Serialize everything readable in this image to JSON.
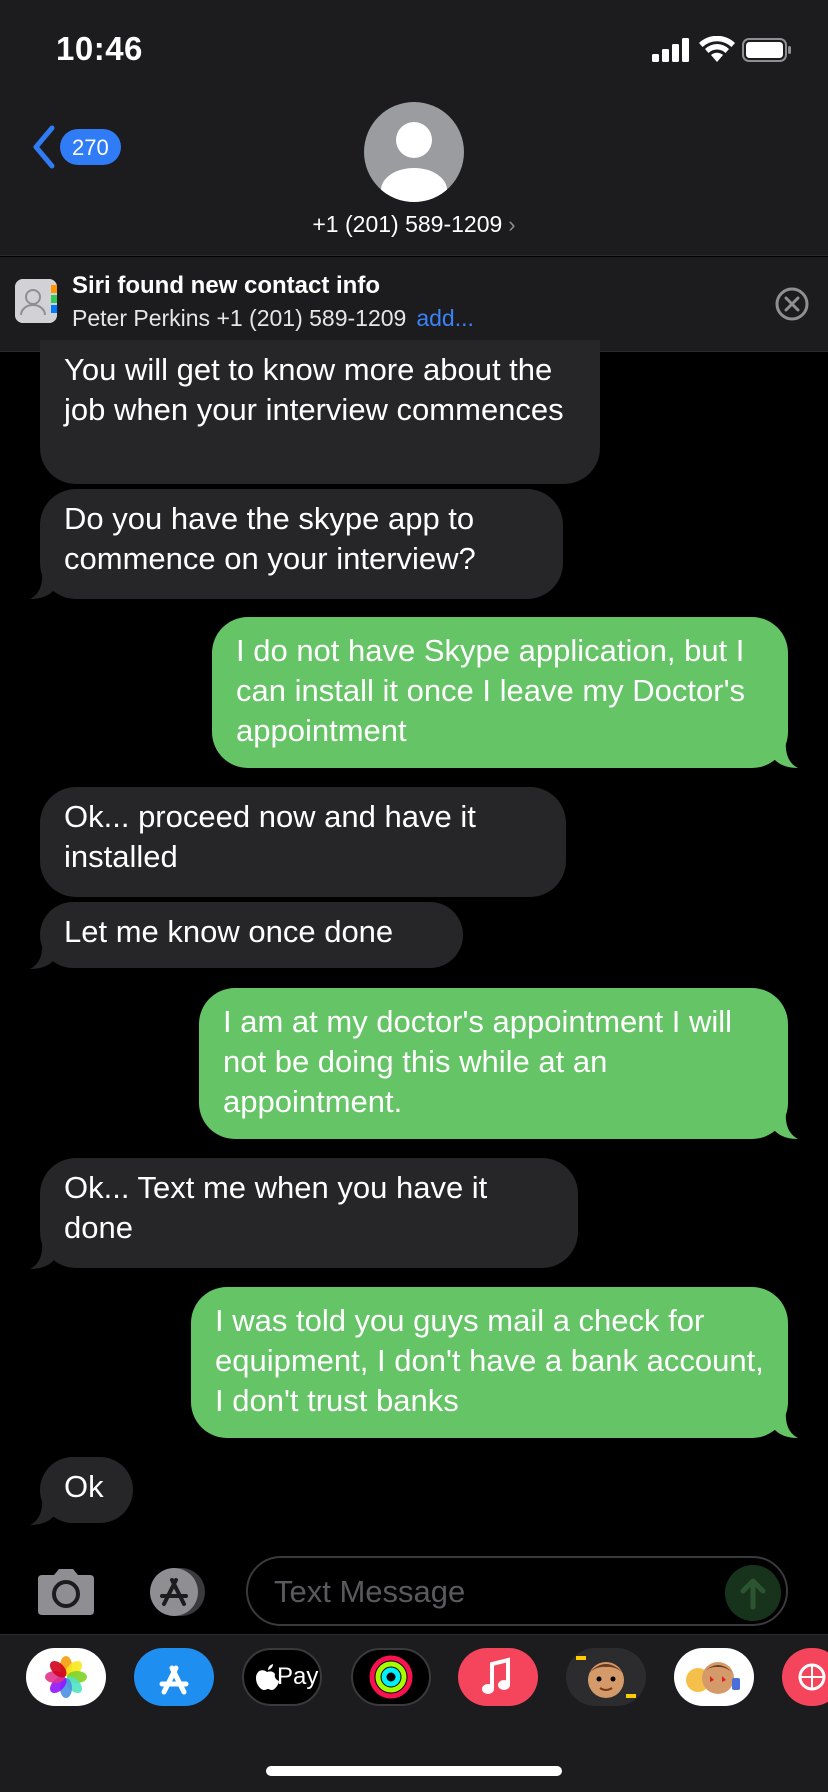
{
  "status_bar": {
    "time": "10:46"
  },
  "nav": {
    "back_count": "270",
    "contact_number": "+1 (201) 589-1209",
    "chevron": "›"
  },
  "siri_banner": {
    "title": "Siri found new contact info",
    "contact": "Peter Perkins +1 (201) 589-1209",
    "add_label": "add..."
  },
  "messages": [
    {
      "dir": "in",
      "text": "You will get to know more about the job when your interview commences"
    },
    {
      "dir": "in",
      "text": "Do you have the skype app to commence on your interview?"
    },
    {
      "dir": "out",
      "text": "I do not have Skype application, but I can install it once I leave my Doctor's appointment"
    },
    {
      "dir": "in",
      "text": "Ok... proceed now and have it installed"
    },
    {
      "dir": "in",
      "text": "Let me know once done"
    },
    {
      "dir": "out",
      "text": "I am at my doctor's appointment I will not be doing this while at an appointment."
    },
    {
      "dir": "in",
      "text": "Ok... Text me when you have it done"
    },
    {
      "dir": "out",
      "text": "I was told you guys mail a check for equipment, I don't have a bank account, I don't trust banks"
    },
    {
      "dir": "in",
      "text": "Ok"
    }
  ],
  "input": {
    "placeholder": "Text Message"
  },
  "apps": [
    {
      "name": "photos-app-icon"
    },
    {
      "name": "app-store-app-icon"
    },
    {
      "name": "apple-pay-app-icon",
      "label": "Pay"
    },
    {
      "name": "activity-app-icon"
    },
    {
      "name": "music-app-icon"
    },
    {
      "name": "memoji-app-icon"
    },
    {
      "name": "memoji-stickers-app-icon"
    },
    {
      "name": "search-images-app-icon"
    }
  ],
  "colors": {
    "incoming": "#262628",
    "outgoing": "#65c466",
    "accent": "#2f7cf6"
  }
}
